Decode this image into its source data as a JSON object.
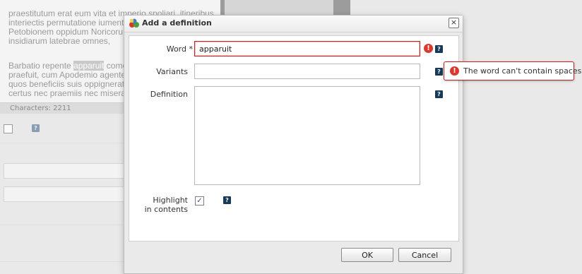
{
  "background": {
    "editor_paragraphs": [
      "praestitutum erat eum vita et imperio spoliari, itineribus interiectis permutatione iumentorum emensis venit Petobionem oppidum Noricorum, ubi reseratae sunt insidiarum latebrae omnes,",
      "Barbatio repente apparuit comes, qui sub eo domesticis praefuit, cum Apodemio agente in rebus milites ducens, quos beneficiis suis oppigneratos elegerat imperator certus nec praemiis nec miseratione ulla posse deflecti."
    ],
    "selected_word": "apparuit",
    "status_characters": "Characters: 2211"
  },
  "dialog": {
    "title": "Add a definition",
    "close_glyph": "×",
    "word_label": "Word *",
    "word_value": "apparuit",
    "variants_label": "Variants",
    "variants_value": "",
    "definition_label": "Definition",
    "definition_value": "",
    "highlight_label": "Highlight in contents",
    "highlight_checked": true,
    "help_glyph": "?",
    "error_glyph": "!",
    "ok_label": "OK",
    "cancel_label": "Cancel"
  },
  "tooltip": {
    "message": "The word can't contain spaces."
  },
  "colors": {
    "error": "#c32020",
    "help_icon": "#173a5a"
  }
}
